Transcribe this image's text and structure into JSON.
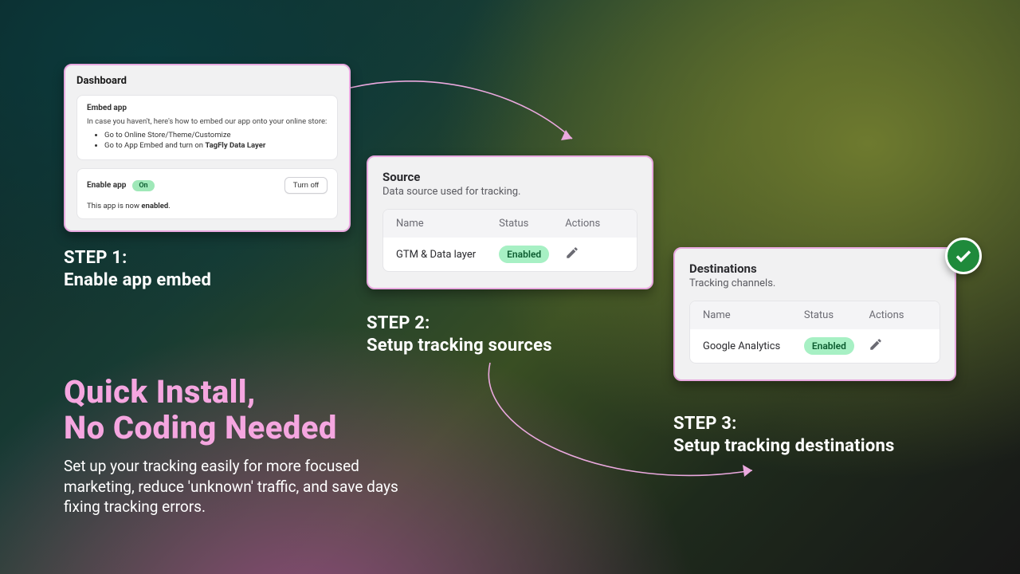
{
  "hero": {
    "title_line1": "Quick Install,",
    "title_line2": "No Coding Needed",
    "body": "Set up your tracking easily for more focused marketing, reduce 'unknown' traffic, and save days fixing tracking errors."
  },
  "steps": {
    "s1_label": "STEP 1:",
    "s1_text": "Enable app embed",
    "s2_label": "STEP 2:",
    "s2_text": "Setup tracking sources",
    "s3_label": "STEP 3:",
    "s3_text": "Setup tracking destinations"
  },
  "card1": {
    "title": "Dashboard",
    "embed": {
      "title": "Embed app",
      "intro": "In case you haven't, here's how to embed our app onto your online store:",
      "bullet1": "Go to Online Store/Theme/Customize",
      "bullet2_prefix": "Go to App Embed and turn on ",
      "bullet2_strong": "TagFly Data Layer"
    },
    "enable": {
      "title": "Enable app",
      "pill": "On",
      "button": "Turn off",
      "status_prefix": "This app is now ",
      "status_strong": "enabled",
      "status_suffix": "."
    }
  },
  "card2": {
    "title": "Source",
    "subtitle": "Data source used for tracking.",
    "columns": {
      "name": "Name",
      "status": "Status",
      "actions": "Actions"
    },
    "row": {
      "name": "GTM & Data layer",
      "status": "Enabled"
    }
  },
  "card3": {
    "title": "Destinations",
    "subtitle": "Tracking channels.",
    "columns": {
      "name": "Name",
      "status": "Status",
      "actions": "Actions"
    },
    "row": {
      "name": "Google Analytics",
      "status": "Enabled"
    }
  }
}
